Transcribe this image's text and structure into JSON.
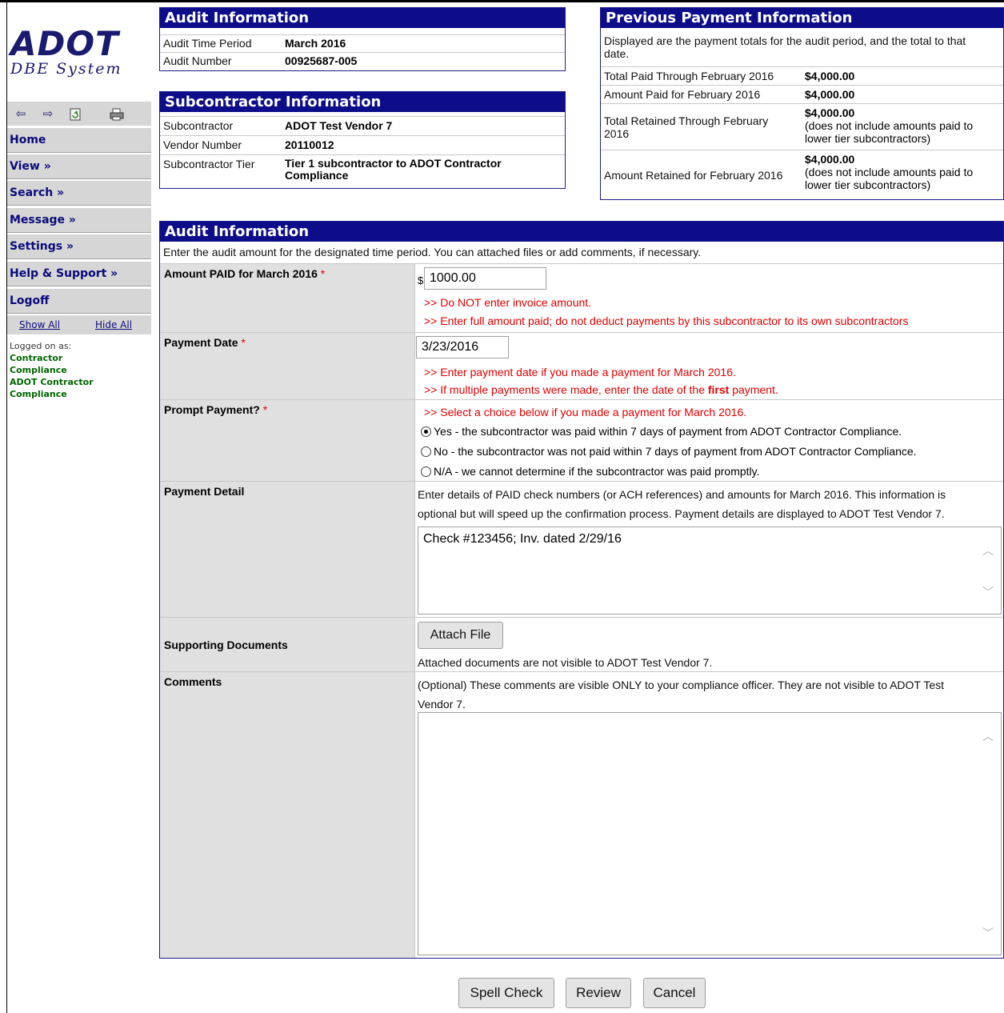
{
  "logo": {
    "brand": "ADOT",
    "system": "DBE System"
  },
  "toolbar": {
    "back_icon": "⇦",
    "forward_icon": "⇨"
  },
  "sidebar": {
    "items": [
      {
        "label": "Home"
      },
      {
        "label": "View »"
      },
      {
        "label": "Search »"
      },
      {
        "label": "Message »"
      },
      {
        "label": "Settings »"
      },
      {
        "label": "Help & Support »"
      },
      {
        "label": "Logoff"
      }
    ],
    "show_all": "Show All",
    "hide_all": "Hide All",
    "logged_on_label": "Logged on as:",
    "user_line1": "Contractor",
    "user_line2": "Compliance",
    "user_line3": "ADOT Contractor",
    "user_line4": "Compliance"
  },
  "audit_info": {
    "title": "Audit Information",
    "time_period_label": "Audit Time Period",
    "time_period_value": "March 2016",
    "number_label": "Audit Number",
    "number_value": "00925687-005"
  },
  "subcontractor_info": {
    "title": "Subcontractor Information",
    "sub_label": "Subcontractor",
    "sub_value": "ADOT Test Vendor 7",
    "vendor_label": "Vendor Number",
    "vendor_value": "20110012",
    "tier_label": "Subcontractor Tier",
    "tier_value_1": "Tier 1 subcontractor to ADOT Contractor",
    "tier_value_2": "Compliance"
  },
  "previous_payment": {
    "title": "Previous Payment Information",
    "intro_1": "Displayed are the payment totals for the audit period, and the total to that",
    "intro_2": "date.",
    "rows": [
      {
        "label": "Total Paid Through February 2016",
        "value": "$4,000.00"
      },
      {
        "label": "Amount Paid for February 2016",
        "value": "$4,000.00"
      },
      {
        "label_1": "Total Retained Through February",
        "label_2": "2016",
        "value": "$4,000.00",
        "note_1": "(does not include amounts paid to",
        "note_2": "lower tier subcontractors)"
      },
      {
        "label": "Amount Retained for February 2016",
        "value": "$4,000.00",
        "note_1": "(does not include amounts paid to",
        "note_2": "lower tier subcontractors)"
      }
    ]
  },
  "form": {
    "title": "Audit Information",
    "intro": "Enter the audit amount for the designated time period. You can attached files or add comments, if necessary.",
    "amount_label": "Amount PAID for March 2016",
    "required_mark": "*",
    "currency": "$",
    "amount_value": "1000.00",
    "amount_hint_1": ">> Do NOT enter invoice amount.",
    "amount_hint_2": ">> Enter full amount paid; do not deduct payments by this subcontractor to its own subcontractors",
    "date_label": "Payment Date",
    "date_value": "3/23/2016",
    "date_hint_1": ">> Enter payment date if you made a payment for March 2016.",
    "date_hint_2_pre": ">> If multiple payments were made, enter the date of the",
    "date_hint_2_bold": "first",
    "date_hint_2_post": "payment.",
    "prompt_label": "Prompt Payment?",
    "prompt_hint": ">> Select a choice below if you made a payment for March 2016.",
    "prompt_options": [
      {
        "label": "Yes - the subcontractor was paid within 7 days of payment from ADOT Contractor Compliance.",
        "selected": true
      },
      {
        "label": "No - the subcontractor was not paid within 7 days of payment from ADOT Contractor Compliance.",
        "selected": false
      },
      {
        "label": "N/A - we cannot determine if the subcontractor was paid promptly.",
        "selected": false
      }
    ],
    "detail_label": "Payment Detail",
    "detail_intro_1": "Enter details of PAID check numbers (or ACH references) and amounts for March 2016. This information is",
    "detail_intro_2": "optional but will speed up the confirmation process. Payment details are displayed to ADOT Test Vendor 7.",
    "detail_value": "Check #123456; Inv. dated 2/29/16",
    "docs_label": "Supporting Documents",
    "attach_button": "Attach File",
    "docs_note": "Attached documents are not visible to ADOT Test Vendor 7.",
    "comments_label": "Comments",
    "comments_intro_1": "(Optional) These comments are visible ONLY to your compliance officer. They are not visible to ADOT Test",
    "comments_intro_2": "Vendor 7.",
    "comments_value": ""
  },
  "buttons": {
    "spell_check": "Spell Check",
    "review": "Review",
    "cancel": "Cancel"
  }
}
